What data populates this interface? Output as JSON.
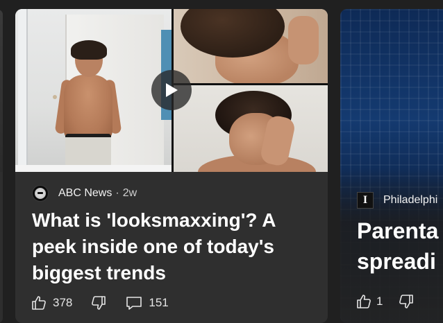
{
  "main_card": {
    "source": {
      "name": "ABC News",
      "separator": "·",
      "age": "2w"
    },
    "headline": "What is 'looksmaxxing'? A peek inside one of today's biggest trends",
    "has_video": true,
    "actions": {
      "likes": "378",
      "comments": "151"
    }
  },
  "right_card": {
    "source": {
      "name": "Philadelphi"
    },
    "headline_line1": "Parenta",
    "headline_line2": "spreadi",
    "actions": {
      "likes": "1"
    }
  },
  "colors": {
    "background": "#202020",
    "card": "#2f2f2f",
    "text_primary": "#ffffff",
    "text_secondary": "#cfcfcf"
  },
  "icons": {
    "play": "play-icon",
    "like": "thumbs-up-icon",
    "dislike": "thumbs-down-icon",
    "comment": "comment-icon"
  }
}
